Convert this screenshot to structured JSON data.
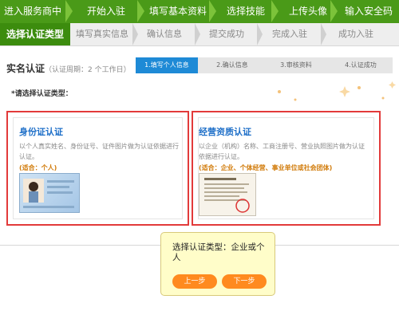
{
  "topbar": {
    "steps": [
      "进入服务商中心",
      "开始入驻",
      "填写基本资料",
      "选择技能",
      "上传头像",
      "输入安全码"
    ]
  },
  "tabs": [
    {
      "label": "选择认证类型",
      "active": true
    },
    {
      "label": "填写真实信息",
      "active": false
    },
    {
      "label": "确认信息",
      "active": false
    },
    {
      "label": "提交成功",
      "active": false
    },
    {
      "label": "完成入驻",
      "active": false
    },
    {
      "label": "成功入驻",
      "active": false
    }
  ],
  "section": {
    "title": "实名认证",
    "period": "（认证周期：2 个工作日）",
    "hint": "*请选择认证类型："
  },
  "progress_steps": [
    "1.填写个人信息",
    "2.确认信息",
    "3.审核资料",
    "4.认证成功"
  ],
  "cards": {
    "id_card": {
      "title": "身份证认证",
      "desc": "以个人真实姓名、身份证号、证件图片做为认证依据进行认证。",
      "fit": "(适合：个人)"
    },
    "business": {
      "title": "经营资质认证",
      "desc": "以企业（机构）名称、工商注册号、营业执照图片做为认证依据进行认证。",
      "fit": "(适合：企业、个体经营、事业单位或社会团体)"
    }
  },
  "tooltip": {
    "text": "选择认证类型：企业或个人",
    "prev": "上一步",
    "next": "下一步"
  },
  "colors": {
    "green_dark": "#3c8c0e",
    "green_bar": "#4a9a18",
    "blue_step": "#1e8ad6",
    "red_border": "#e23a3a",
    "orange_button": "#ff8a1f",
    "tooltip_bg": "#fffdc9"
  }
}
